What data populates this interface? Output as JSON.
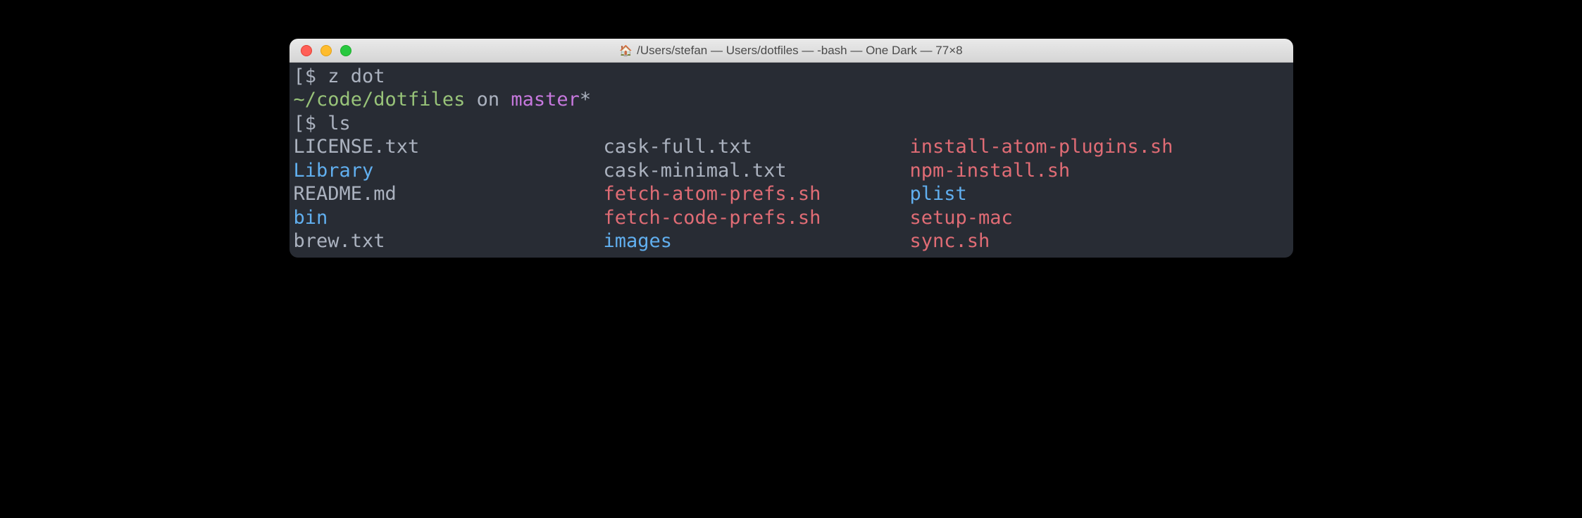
{
  "window": {
    "title": "/Users/stefan — Users/dotfiles — -bash — One Dark — 77×8",
    "icon": "🏠"
  },
  "lines": {
    "l1_bracket_open": "[",
    "l1_prompt": "$ ",
    "l1_cmd": "z dot",
    "l2_path": "~/code/dotfiles",
    "l2_on": " on ",
    "l2_branch": "master",
    "l2_star": "*",
    "l3_bracket_open": "[",
    "l3_prompt": "$ ",
    "l3_cmd": "ls"
  },
  "listing": {
    "col1": [
      {
        "name": "LICENSE.txt",
        "type": "file"
      },
      {
        "name": "Library",
        "type": "dir"
      },
      {
        "name": "README.md",
        "type": "file"
      },
      {
        "name": "bin",
        "type": "dir"
      },
      {
        "name": "brew.txt",
        "type": "file"
      }
    ],
    "col2": [
      {
        "name": "cask-full.txt",
        "type": "file"
      },
      {
        "name": "cask-minimal.txt",
        "type": "file"
      },
      {
        "name": "fetch-atom-prefs.sh",
        "type": "exec"
      },
      {
        "name": "fetch-code-prefs.sh",
        "type": "exec"
      },
      {
        "name": "images",
        "type": "dir"
      }
    ],
    "col3": [
      {
        "name": "install-atom-plugins.sh",
        "type": "exec"
      },
      {
        "name": "npm-install.sh",
        "type": "exec"
      },
      {
        "name": "plist",
        "type": "dir"
      },
      {
        "name": "setup-mac",
        "type": "exec"
      },
      {
        "name": "sync.sh",
        "type": "exec"
      }
    ]
  },
  "colors": {
    "bg": "#282c34",
    "fg": "#abb2bf",
    "green": "#98c379",
    "purple": "#c678dd",
    "blue": "#61afef",
    "red": "#e06c75"
  }
}
